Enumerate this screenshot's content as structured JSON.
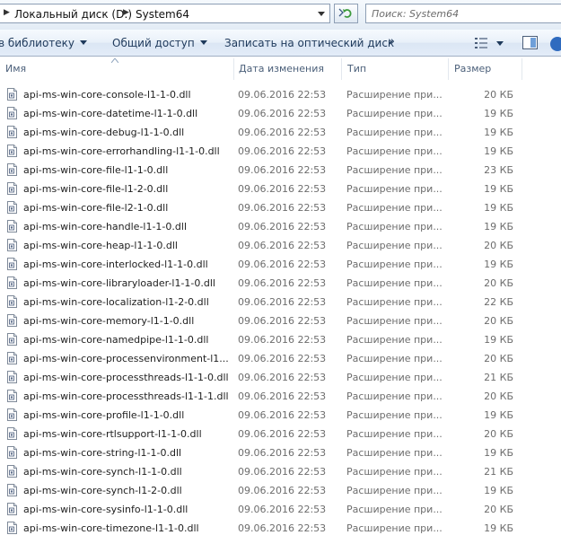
{
  "address_bar": {
    "path": [
      "Локальный диск (D:)",
      "System64"
    ]
  },
  "search": {
    "placeholder": "Поиск: System64"
  },
  "toolbar": {
    "library_label": "в библиотеку",
    "share_label": "Общий доступ",
    "burn_label": "Записать на оптический диск",
    "more_label": "»"
  },
  "columns": {
    "name": "Имя",
    "date": "Дата изменения",
    "type": "Тип",
    "size": "Размер"
  },
  "files": [
    {
      "name": "api-ms-win-core-console-l1-1-0.dll",
      "date": "09.06.2016 22:53",
      "type": "Расширение при...",
      "size": "20 КБ"
    },
    {
      "name": "api-ms-win-core-datetime-l1-1-0.dll",
      "date": "09.06.2016 22:53",
      "type": "Расширение при...",
      "size": "19 КБ"
    },
    {
      "name": "api-ms-win-core-debug-l1-1-0.dll",
      "date": "09.06.2016 22:53",
      "type": "Расширение при...",
      "size": "19 КБ"
    },
    {
      "name": "api-ms-win-core-errorhandling-l1-1-0.dll",
      "date": "09.06.2016 22:53",
      "type": "Расширение при...",
      "size": "19 КБ"
    },
    {
      "name": "api-ms-win-core-file-l1-1-0.dll",
      "date": "09.06.2016 22:53",
      "type": "Расширение при...",
      "size": "23 КБ"
    },
    {
      "name": "api-ms-win-core-file-l1-2-0.dll",
      "date": "09.06.2016 22:53",
      "type": "Расширение при...",
      "size": "19 КБ"
    },
    {
      "name": "api-ms-win-core-file-l2-1-0.dll",
      "date": "09.06.2016 22:53",
      "type": "Расширение при...",
      "size": "19 КБ"
    },
    {
      "name": "api-ms-win-core-handle-l1-1-0.dll",
      "date": "09.06.2016 22:53",
      "type": "Расширение при...",
      "size": "19 КБ"
    },
    {
      "name": "api-ms-win-core-heap-l1-1-0.dll",
      "date": "09.06.2016 22:53",
      "type": "Расширение при...",
      "size": "20 КБ"
    },
    {
      "name": "api-ms-win-core-interlocked-l1-1-0.dll",
      "date": "09.06.2016 22:53",
      "type": "Расширение при...",
      "size": "19 КБ"
    },
    {
      "name": "api-ms-win-core-libraryloader-l1-1-0.dll",
      "date": "09.06.2016 22:53",
      "type": "Расширение при...",
      "size": "20 КБ"
    },
    {
      "name": "api-ms-win-core-localization-l1-2-0.dll",
      "date": "09.06.2016 22:53",
      "type": "Расширение при...",
      "size": "22 КБ"
    },
    {
      "name": "api-ms-win-core-memory-l1-1-0.dll",
      "date": "09.06.2016 22:53",
      "type": "Расширение при...",
      "size": "20 КБ"
    },
    {
      "name": "api-ms-win-core-namedpipe-l1-1-0.dll",
      "date": "09.06.2016 22:53",
      "type": "Расширение при...",
      "size": "19 КБ"
    },
    {
      "name": "api-ms-win-core-processenvironment-l1...",
      "date": "09.06.2016 22:53",
      "type": "Расширение при...",
      "size": "20 КБ"
    },
    {
      "name": "api-ms-win-core-processthreads-l1-1-0.dll",
      "date": "09.06.2016 22:53",
      "type": "Расширение при...",
      "size": "21 КБ"
    },
    {
      "name": "api-ms-win-core-processthreads-l1-1-1.dll",
      "date": "09.06.2016 22:53",
      "type": "Расширение при...",
      "size": "20 КБ"
    },
    {
      "name": "api-ms-win-core-profile-l1-1-0.dll",
      "date": "09.06.2016 22:53",
      "type": "Расширение при...",
      "size": "19 КБ"
    },
    {
      "name": "api-ms-win-core-rtlsupport-l1-1-0.dll",
      "date": "09.06.2016 22:53",
      "type": "Расширение при...",
      "size": "20 КБ"
    },
    {
      "name": "api-ms-win-core-string-l1-1-0.dll",
      "date": "09.06.2016 22:53",
      "type": "Расширение при...",
      "size": "19 КБ"
    },
    {
      "name": "api-ms-win-core-synch-l1-1-0.dll",
      "date": "09.06.2016 22:53",
      "type": "Расширение при...",
      "size": "21 КБ"
    },
    {
      "name": "api-ms-win-core-synch-l1-2-0.dll",
      "date": "09.06.2016 22:53",
      "type": "Расширение при...",
      "size": "19 КБ"
    },
    {
      "name": "api-ms-win-core-sysinfo-l1-1-0.dll",
      "date": "09.06.2016 22:53",
      "type": "Расширение при...",
      "size": "20 КБ"
    },
    {
      "name": "api-ms-win-core-timezone-l1-1-0.dll",
      "date": "09.06.2016 22:53",
      "type": "Расширение при...",
      "size": "19 КБ"
    }
  ]
}
